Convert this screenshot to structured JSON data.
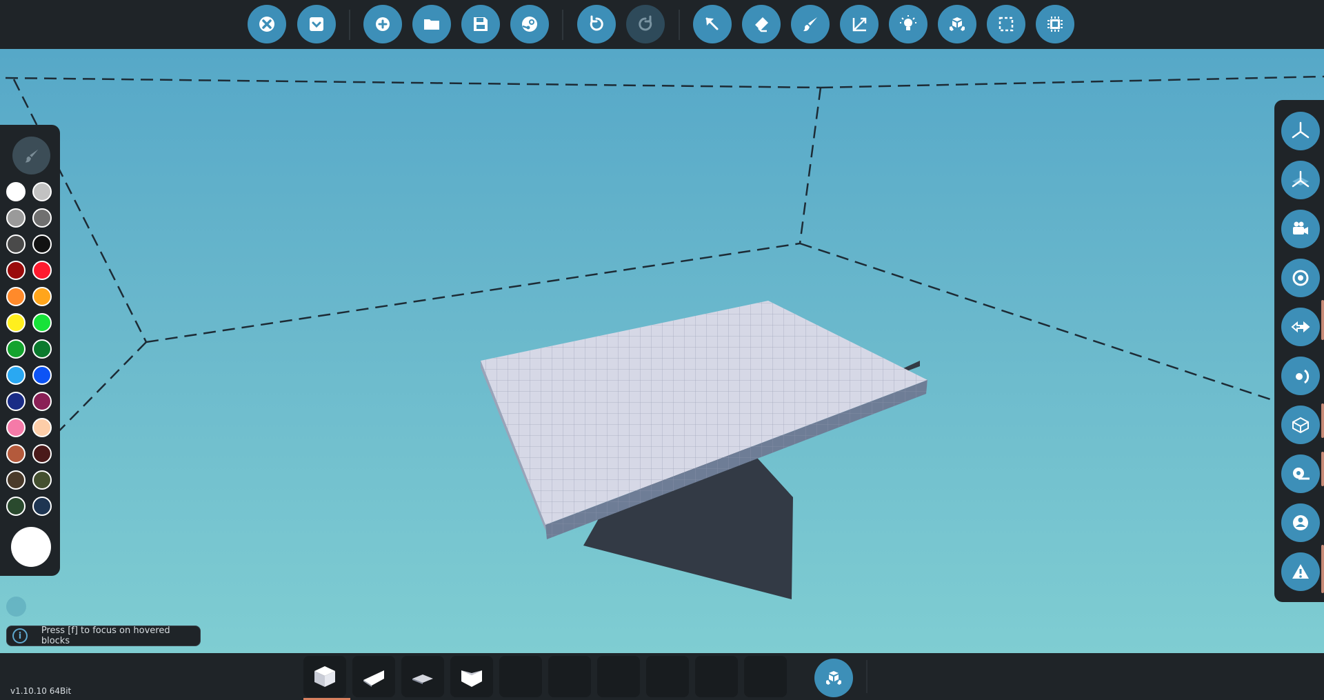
{
  "toolbar": {
    "buttons": [
      {
        "id": "close",
        "icon": "close-circle-icon"
      },
      {
        "id": "collapse",
        "icon": "chevron-down-box-icon"
      },
      {
        "id": "new",
        "icon": "plus-circle-icon"
      },
      {
        "id": "open",
        "icon": "folder-icon"
      },
      {
        "id": "save",
        "icon": "floppy-disk-icon"
      },
      {
        "id": "steam",
        "icon": "steam-icon"
      },
      {
        "id": "undo",
        "icon": "undo-icon"
      },
      {
        "id": "redo",
        "icon": "redo-icon",
        "disabled": true
      },
      {
        "id": "select",
        "icon": "cursor-arrow-icon"
      },
      {
        "id": "erase",
        "icon": "eraser-icon"
      },
      {
        "id": "paint",
        "icon": "paint-brush-icon"
      },
      {
        "id": "scale",
        "icon": "resize-arrows-icon"
      },
      {
        "id": "lights",
        "icon": "light-bulb-icon"
      },
      {
        "id": "blocks",
        "icon": "cubes-icon"
      },
      {
        "id": "area-select",
        "icon": "dashed-selection-icon"
      },
      {
        "id": "logic",
        "icon": "microchip-icon"
      }
    ]
  },
  "palette": {
    "brush_icon": "paint-brush-icon",
    "colors": [
      "#ffffff",
      "#c2c2c2",
      "#9a9a9a",
      "#707070",
      "#4a4a4a",
      "#121212",
      "#9a0b0b",
      "#ff1a2e",
      "#ff8a2b",
      "#ffa51c",
      "#ffef1e",
      "#17e239",
      "#14a32e",
      "#0b7a2e",
      "#2aa8f2",
      "#0d54f5",
      "#1a2c86",
      "#8a2056",
      "#f57aa8",
      "#fdcda8",
      "#b45a3c",
      "#4a1a1a",
      "#4a3a2a",
      "#445030",
      "#2a4a2e",
      "#1e3552"
    ],
    "current_color": "#ffffff"
  },
  "view_tools": [
    {
      "id": "axis-view-1",
      "icon": "axes-icon"
    },
    {
      "id": "axis-view-2",
      "icon": "axes-plane-icon"
    },
    {
      "id": "camera",
      "icon": "camera-icon"
    },
    {
      "id": "center-of-mass",
      "icon": "target-icon"
    },
    {
      "id": "connections",
      "icon": "arrows-horizontal-icon"
    },
    {
      "id": "rotation",
      "icon": "rotate-icon"
    },
    {
      "id": "block-bounds",
      "icon": "box-outline-icon"
    },
    {
      "id": "measure",
      "icon": "tape-measure-icon"
    },
    {
      "id": "seat",
      "icon": "pilot-seat-icon"
    },
    {
      "id": "warnings",
      "icon": "warning-icon"
    }
  ],
  "hint": {
    "icon": "info-icon",
    "text": "Press [f] to focus on hovered blocks"
  },
  "hotbar": {
    "slots": [
      {
        "icon": "cube-block-icon",
        "active": true
      },
      {
        "icon": "wedge-block-icon"
      },
      {
        "icon": "flat-plate-icon"
      },
      {
        "icon": "corner-block-icon"
      },
      {
        "icon": ""
      },
      {
        "icon": ""
      },
      {
        "icon": ""
      },
      {
        "icon": ""
      },
      {
        "icon": ""
      },
      {
        "icon": ""
      }
    ],
    "inventory_icon": "cubes-icon"
  },
  "version": "v1.10.10 64Bit"
}
